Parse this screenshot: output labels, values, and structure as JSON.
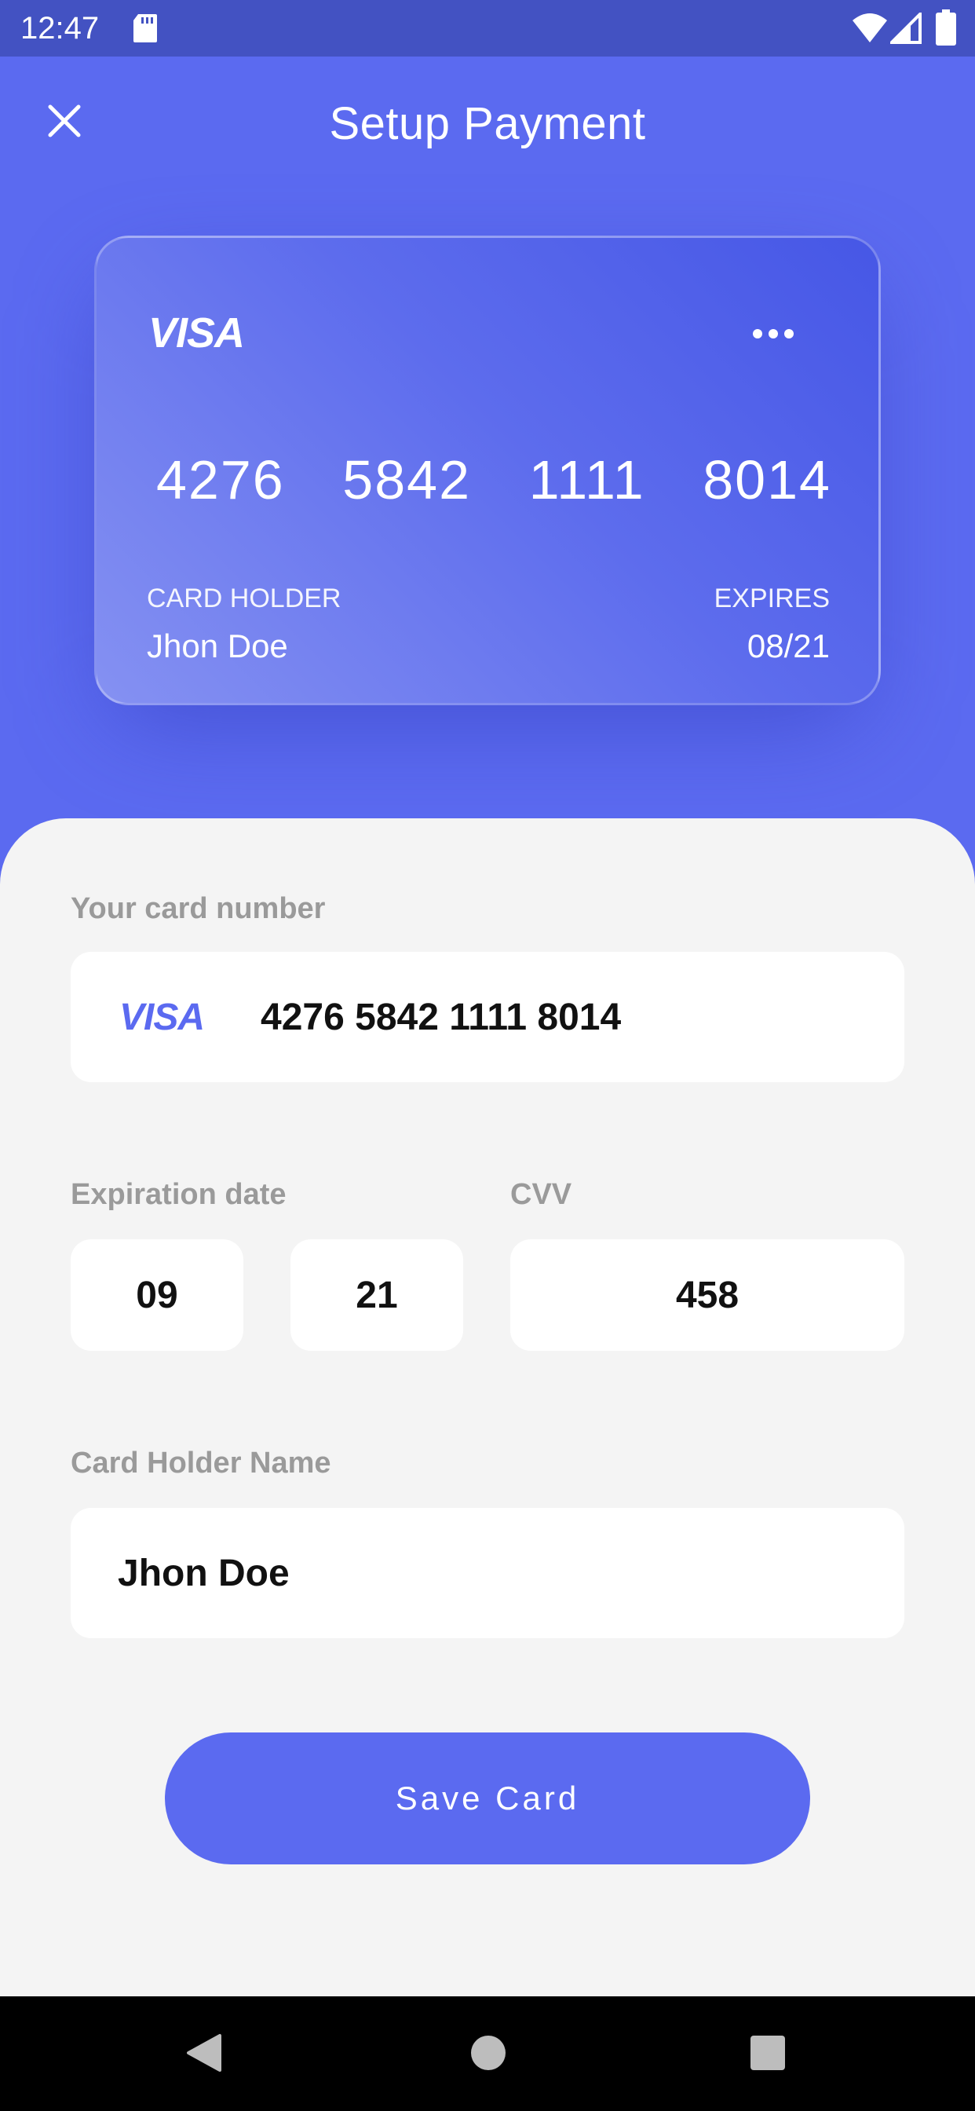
{
  "status_bar": {
    "time": "12:47"
  },
  "header": {
    "title": "Setup Payment"
  },
  "card": {
    "brand": "VISA",
    "number_groups": [
      "4276",
      "5842",
      "1111",
      "8014"
    ],
    "holder_label": "CARD HOLDER",
    "holder_name": "Jhon Doe",
    "expires_label": "EXPIRES",
    "expires_value": "08/21"
  },
  "form": {
    "card_number_label": "Your card number",
    "card_brand": "VISA",
    "card_number_value": "4276 5842 1111 8014",
    "expiration_label": "Expiration date",
    "exp_month": "09",
    "exp_year": "21",
    "cvv_label": "CVV",
    "cvv_value": "458",
    "holder_label": "Card Holder Name",
    "holder_value": "Jhon Doe",
    "save_label": "Save Card"
  },
  "colors": {
    "accent": "#5b6af0",
    "status_bar": "#4352c2",
    "sheet": "#f4f4f4",
    "label": "#9a9a9a"
  },
  "icons": {
    "close": "close-icon",
    "card_menu": "more-horizontal-icon",
    "sd": "sd-card-icon",
    "wifi": "wifi-icon",
    "signal": "signal-icon",
    "battery": "battery-icon"
  }
}
